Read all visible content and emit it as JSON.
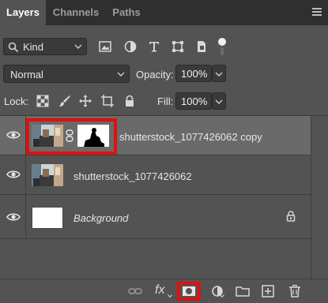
{
  "tabs": [
    {
      "label": "Layers",
      "active": true
    },
    {
      "label": "Channels",
      "active": false
    },
    {
      "label": "Paths",
      "active": false
    }
  ],
  "filter": {
    "kind_label": "Kind"
  },
  "blend": {
    "mode": "Normal",
    "opacity_label": "Opacity:",
    "opacity_value": "100%"
  },
  "lock": {
    "label": "Lock:",
    "fill_label": "Fill:",
    "fill_value": "100%"
  },
  "layers": [
    {
      "name": "shutterstock_1077426062 copy",
      "selected": true,
      "has_mask": true
    },
    {
      "name": "shutterstock_1077426062",
      "selected": false,
      "has_mask": false
    },
    {
      "name": "Background",
      "selected": false,
      "italic": true,
      "locked": true
    }
  ],
  "bottom_bar": {
    "fx_label": "fx"
  },
  "colors": {
    "highlight": "#e01010",
    "panel_bg": "#535353",
    "tab_bar_bg": "#2f2f2f",
    "selected_row": "#6a6a6a"
  }
}
